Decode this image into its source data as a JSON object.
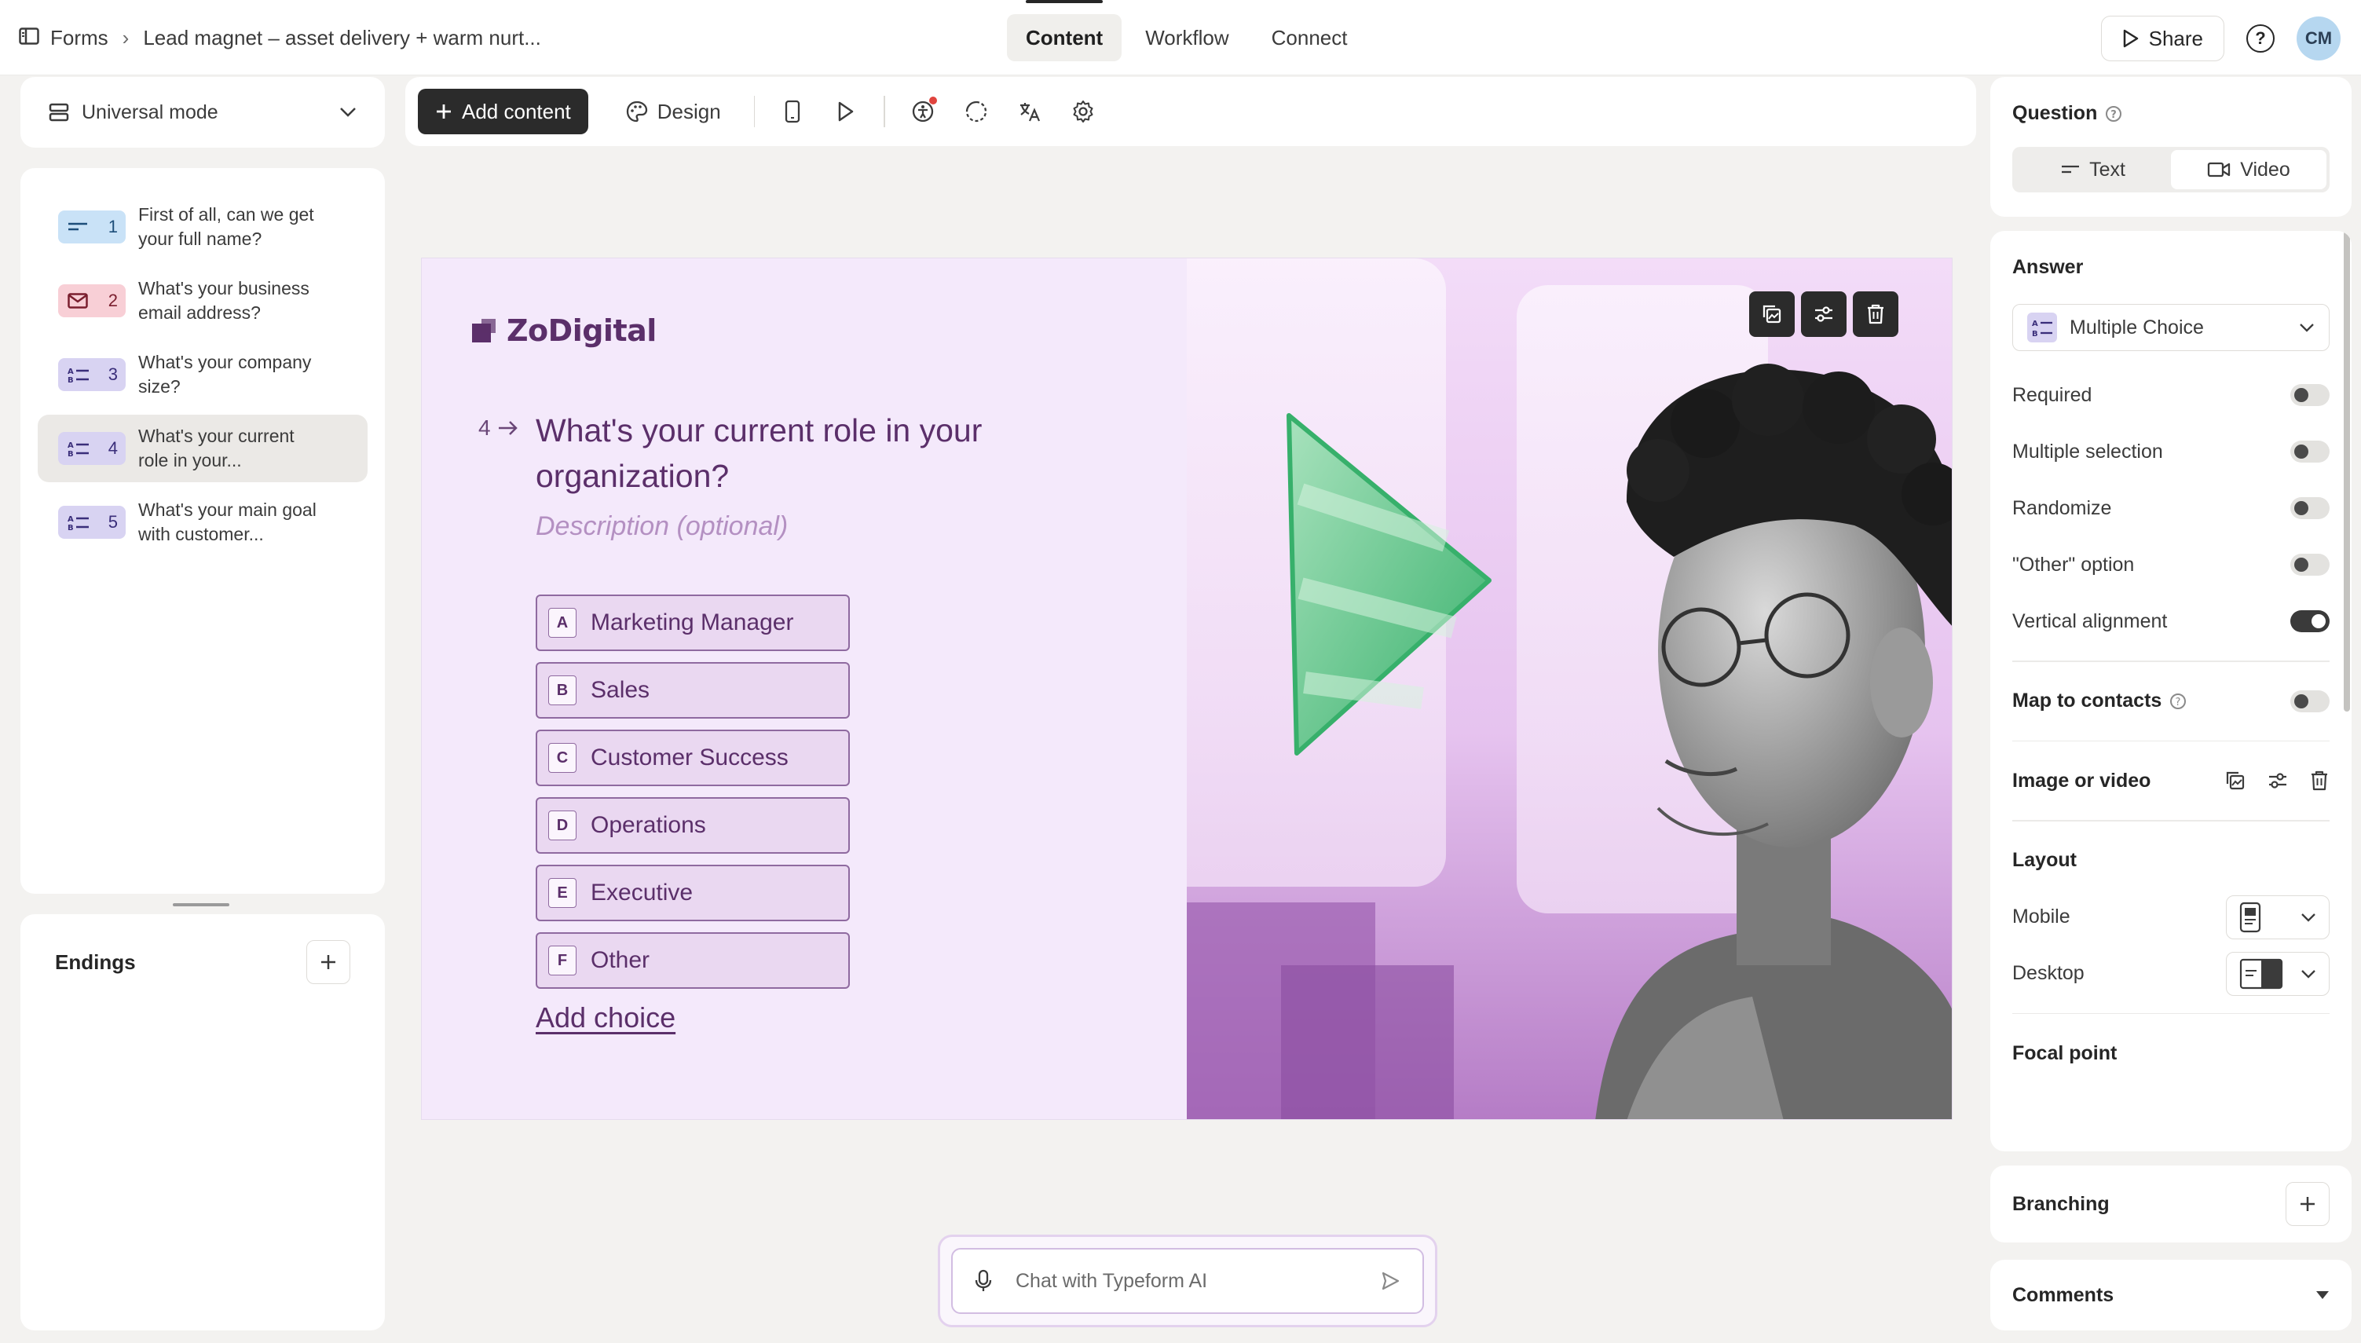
{
  "header": {
    "breadcrumb_root": "Forms",
    "form_title": "Lead magnet – asset delivery + warm nurt...",
    "tabs": [
      {
        "label": "Content",
        "active": true
      },
      {
        "label": "Workflow",
        "active": false
      },
      {
        "label": "Connect",
        "active": false
      }
    ],
    "share_label": "Share",
    "help_glyph": "?",
    "avatar_initials": "CM"
  },
  "sidebar": {
    "mode_label": "Universal mode",
    "questions": [
      {
        "num": "1",
        "text": "First of all, can we get your full name?",
        "icon": "short-text-icon",
        "color": "blue"
      },
      {
        "num": "2",
        "text": "What's your business email address?",
        "icon": "email-icon",
        "color": "red"
      },
      {
        "num": "3",
        "text": "What's your company size?",
        "icon": "multiple-choice-icon",
        "color": "purple"
      },
      {
        "num": "4",
        "text": "What's your current role in your...",
        "icon": "multiple-choice-icon",
        "color": "purple",
        "selected": true
      },
      {
        "num": "5",
        "text": "What's your main goal with customer...",
        "icon": "multiple-choice-icon",
        "color": "purple"
      }
    ],
    "endings_label": "Endings"
  },
  "toolbar": {
    "add_content_label": "Add content",
    "design_label": "Design"
  },
  "preview": {
    "logo_text": "ZoDigital",
    "question_number": "4",
    "question_title": "What's your current role in your organization?",
    "description_placeholder": "Description (optional)",
    "choices": [
      {
        "key": "A",
        "label": "Marketing Manager"
      },
      {
        "key": "B",
        "label": "Sales"
      },
      {
        "key": "C",
        "label": "Customer Success"
      },
      {
        "key": "D",
        "label": "Operations"
      },
      {
        "key": "E",
        "label": "Executive"
      },
      {
        "key": "F",
        "label": "Other"
      }
    ],
    "add_choice_label": "Add choice",
    "colors": {
      "background": "#f4e9fb",
      "text": "#5b2f6a",
      "choice_fill": "#ead8f1"
    }
  },
  "chat": {
    "placeholder": "Chat with Typeform AI"
  },
  "right_panel": {
    "question_label": "Question",
    "question_types": [
      {
        "label": "Text",
        "active": true
      },
      {
        "label": "Video",
        "active": false
      }
    ],
    "answer_label": "Answer",
    "answer_type": "Multiple Choice",
    "toggles": [
      {
        "label": "Required",
        "on": false
      },
      {
        "label": "Multiple selection",
        "on": false
      },
      {
        "label": "Randomize",
        "on": false
      },
      {
        "label": "\"Other\" option",
        "on": false
      },
      {
        "label": "Vertical alignment",
        "on": true
      }
    ],
    "map_to_contacts_label": "Map to contacts",
    "map_to_contacts_on": false,
    "image_or_video_label": "Image or video",
    "layout_label": "Layout",
    "mobile_label": "Mobile",
    "desktop_label": "Desktop",
    "focal_point_label": "Focal point",
    "branching_label": "Branching",
    "comments_label": "Comments"
  }
}
